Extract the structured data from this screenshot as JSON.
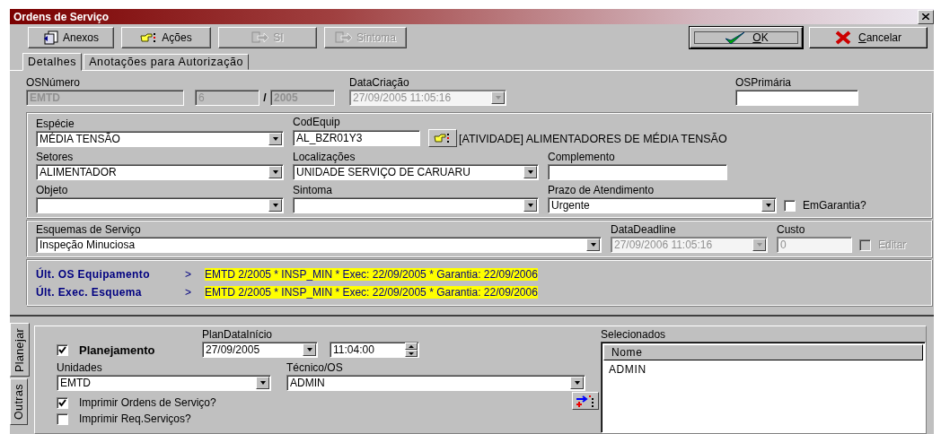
{
  "window": {
    "title": "Ordens de Serviço"
  },
  "toolbar": [
    {
      "label": "Anexos",
      "kind": "anexos",
      "disabled": false
    },
    {
      "label": "Ações",
      "kind": "acoes",
      "disabled": false
    },
    {
      "label": "SI",
      "kind": "forward",
      "disabled": true
    },
    {
      "label": "Sintoma",
      "kind": "forward",
      "disabled": true
    }
  ],
  "dialog_buttons": [
    {
      "label": "OK",
      "kind": "ok",
      "default": true
    },
    {
      "label": "Cancelar",
      "kind": "cancel",
      "default": false
    }
  ],
  "tabs": [
    {
      "label": "Detalhes",
      "selected": true
    },
    {
      "label": "Anotações para Autorização",
      "selected": false
    }
  ],
  "header": {
    "os_numero": {
      "label": "OSNúmero",
      "prefix": "EMTD",
      "number": "6",
      "separator": "/",
      "year": "2005"
    },
    "data_criacao": {
      "label": "DataCriação",
      "value": "27/09/2005 11:05:16",
      "disabled": true
    },
    "os_primaria": {
      "label": "OSPrimária"
    }
  },
  "equipment": {
    "rows": [
      [
        {
          "kind": "combo",
          "label": "Espécie",
          "value": "MÉDIA TENSÃO",
          "disabled": false
        },
        {
          "kind": "lookup",
          "label": "CodEquip",
          "value": "AL_BZR01Y3",
          "disabled": false
        },
        {
          "kind": "note",
          "value": "[ATIVIDADE] ALIMENTADORES DE MÉDIA TENSÃO"
        }
      ],
      [
        {
          "kind": "combo",
          "label": "Setores",
          "value": "ALIMENTADOR",
          "disabled": false
        },
        {
          "kind": "combo",
          "label": "Localizações",
          "value": "UNIDADE SERVIÇO DE CARUARU",
          "disabled": false
        },
        {
          "kind": "text",
          "label": "Complemento",
          "disabled": false
        }
      ],
      [
        {
          "kind": "combo",
          "label": "Objeto",
          "disabled": false
        },
        {
          "kind": "combo",
          "label": "Sintoma",
          "disabled": false
        },
        {
          "kind": "combo",
          "label": "Prazo de Atendimento",
          "value": "Urgente",
          "disabled": false
        },
        {
          "kind": "checkbox",
          "label": "EmGarantia?",
          "checked": false,
          "disabled": false
        }
      ]
    ]
  },
  "schedule": {
    "rows": [
      [
        {
          "kind": "combo",
          "label": "Esquemas de Serviço",
          "value": "Inspeção Minuciosa",
          "disabled": false
        },
        {
          "kind": "combo",
          "label": "DataDeadline",
          "value": "27/09/2006 11:05:16",
          "disabled": true
        },
        {
          "kind": "text",
          "label": "Custo",
          "value": "0",
          "disabled": true
        },
        {
          "kind": "checkbox",
          "label": "Editar",
          "checked": false,
          "disabled": true
        }
      ]
    ]
  },
  "history": [
    {
      "label": "Últ. OS Equipamento",
      "arrow": ">",
      "value": "EMTD 2/2005 * INSP_MIN * Exec: 22/09/2005 * Garantia: 22/09/2006"
    },
    {
      "label": "Últ. Exec. Esquema",
      "arrow": ">",
      "value": "EMTD 2/2005 * INSP_MIN * Exec: 22/09/2005 * Garantia: 22/09/2006"
    }
  ],
  "side_tabs": [
    {
      "label": "Planejar",
      "selected": true
    },
    {
      "label": "Outras",
      "selected": false
    }
  ],
  "planning": {
    "enabled": {
      "label": "Planejamento",
      "checked": true
    },
    "start": {
      "label": "PlanDataInício",
      "date": "27/09/2005",
      "time": "11:04:00"
    },
    "unidades": {
      "label": "Unidades",
      "value": "EMTD"
    },
    "tecnico": {
      "label": "Técnico/OS",
      "value": "ADMIN"
    },
    "options": [
      {
        "label": "Imprimir Ordens de Serviço?",
        "checked": true
      },
      {
        "label": "Imprimir Req.Serviços?",
        "checked": false
      }
    ],
    "selected_list": {
      "label": "Selecionados",
      "columns": [
        "Nome"
      ],
      "rows": [
        [
          "ADMIN"
        ]
      ]
    }
  }
}
